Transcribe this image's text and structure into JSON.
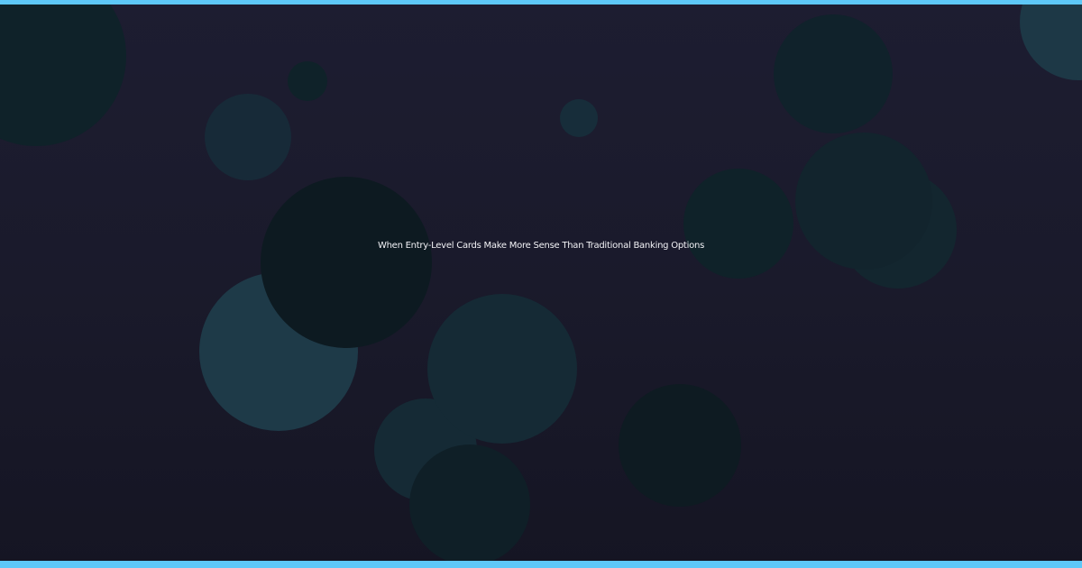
{
  "headline": "When Entry-Level Cards Make More Sense Than Traditional Banking Options",
  "colors": {
    "accent_bar": "#5ec8f8",
    "background_top": "#1d1d31",
    "background_bottom": "#151523",
    "text": "#f2f2f6",
    "bubble_light": "#1e3a48",
    "bubble_mid": "#14303a",
    "bubble_dark": "#0e1c24"
  }
}
